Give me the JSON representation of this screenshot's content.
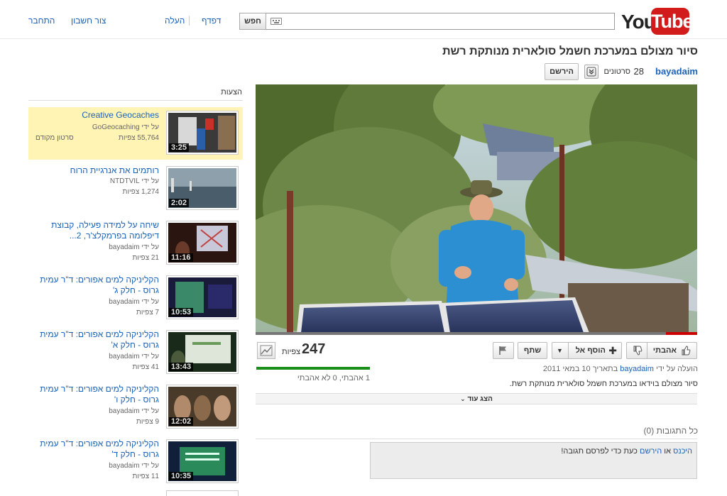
{
  "header": {
    "logo_you": "You",
    "logo_tube": "Tube",
    "search_label": "חפש",
    "search_value": "",
    "links": {
      "browse": "דפדף",
      "upload": "העלה",
      "create_account": "צור חשבון",
      "sign_in": "התחבר"
    }
  },
  "video": {
    "title": "סיור מצולם במערכת חשמל סולארית מנותקת רשת",
    "channel": "bayadaim",
    "video_count": "28",
    "video_count_label": "סרטונים",
    "subscribe_label": "הירשם",
    "views": "247",
    "views_label": "צפיות",
    "like_summary": "1 אהבתי, 0 לא אהבתי",
    "progress_fraction": 0.07,
    "uploaded_prefix": "הועלה על ידי",
    "uploaded_suffix": "בתאריך 10 במאי 2011",
    "description": "סיור מצולם בוידאו במערכת חשמל סולארית מנותקת רשת.",
    "show_more": "הצג עוד"
  },
  "actions": {
    "like": "אהבתי",
    "add_to": "הוסף אל",
    "share": "שתף"
  },
  "comments": {
    "all_comments": "כל התגובות (0)",
    "sign_in": "היכנס",
    "or": "או",
    "subscribe": "הירשם",
    "prompt_rest": "כעת כדי לפרסם תגובה!"
  },
  "sidebar": {
    "header": "הצעות",
    "items": [
      {
        "title": "Creative Geocaches",
        "by": "על ידי GoGeocaching",
        "views": "55,764 צפיות",
        "duration": "3:25",
        "tag": "סרטון מקודם"
      },
      {
        "title": "רותמים את אנרגיית הרוח",
        "by": "על ידי NTDTVIL",
        "views": "1,274 צפיות",
        "duration": "2:02",
        "tag": ""
      },
      {
        "title": "שיחה על למידה פעילה, קבוצת דיפלומה בפרמקלצ'ר, 2...",
        "by": "על ידי bayadaim",
        "views": "21 צפיות",
        "duration": "11:16",
        "tag": ""
      },
      {
        "title": "הקליניקה למים אפורים: ד\"ר עמית גרוס - חלק ג'",
        "by": "על ידי bayadaim",
        "views": "7 צפיות",
        "duration": "10:53",
        "tag": ""
      },
      {
        "title": "הקליניקה למים אפורים: ד\"ר עמית גרוס - חלק א'",
        "by": "על ידי bayadaim",
        "views": "41 צפיות",
        "duration": "13:43",
        "tag": ""
      },
      {
        "title": "הקליניקה למים אפורים: ד\"ר עמית גרוס - חלק ו'",
        "by": "על ידי bayadaim",
        "views": "9 צפיות",
        "duration": "12:02",
        "tag": ""
      },
      {
        "title": "הקליניקה למים אפורים: ד\"ר עמית גרוס - חלק ד'",
        "by": "על ידי bayadaim",
        "views": "11 צפיות",
        "duration": "10:35",
        "tag": ""
      }
    ]
  },
  "colors": {
    "link": "#1c62b9",
    "brand_red": "#d21c1c",
    "highlight": "#fff4b3",
    "like_bar": "#1a8f1a"
  }
}
